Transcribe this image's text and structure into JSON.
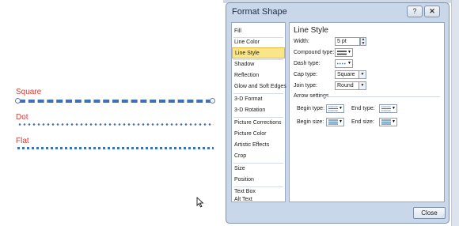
{
  "canvas": {
    "labels": {
      "square": "Square",
      "dot": "Dot",
      "flat": "Flat"
    }
  },
  "dialog": {
    "title": "Format Shape",
    "help_glyph": "?",
    "close_glyph": "✕",
    "nav": [
      "Fill",
      "Line Color",
      "Line Style",
      "Shadow",
      "Reflection",
      "Glow and Soft Edges",
      "3-D Format",
      "3-D Rotation",
      "Picture Corrections",
      "Picture Color",
      "Artistic Effects",
      "Crop",
      "Size",
      "Position",
      "Text Box",
      "Alt Text"
    ],
    "selected_nav": "Line Style",
    "panel": {
      "title": "Line Style",
      "width_label": "Width:",
      "width_value": "5 pt",
      "compound_label": "Compound type:",
      "dash_label": "Dash type:",
      "cap_label": "Cap type:",
      "cap_value": "Square",
      "join_label": "Join type:",
      "join_value": "Round",
      "arrow_section": "Arrow settings",
      "begin_type_label": "Begin type:",
      "end_type_label": "End type:",
      "begin_size_label": "Begin size:",
      "end_size_label": "End size:"
    },
    "close_button": "Close"
  },
  "colors": {
    "line": "#3f6fb5",
    "label": "#e8342a",
    "selected_nav": "#fbe58a"
  }
}
